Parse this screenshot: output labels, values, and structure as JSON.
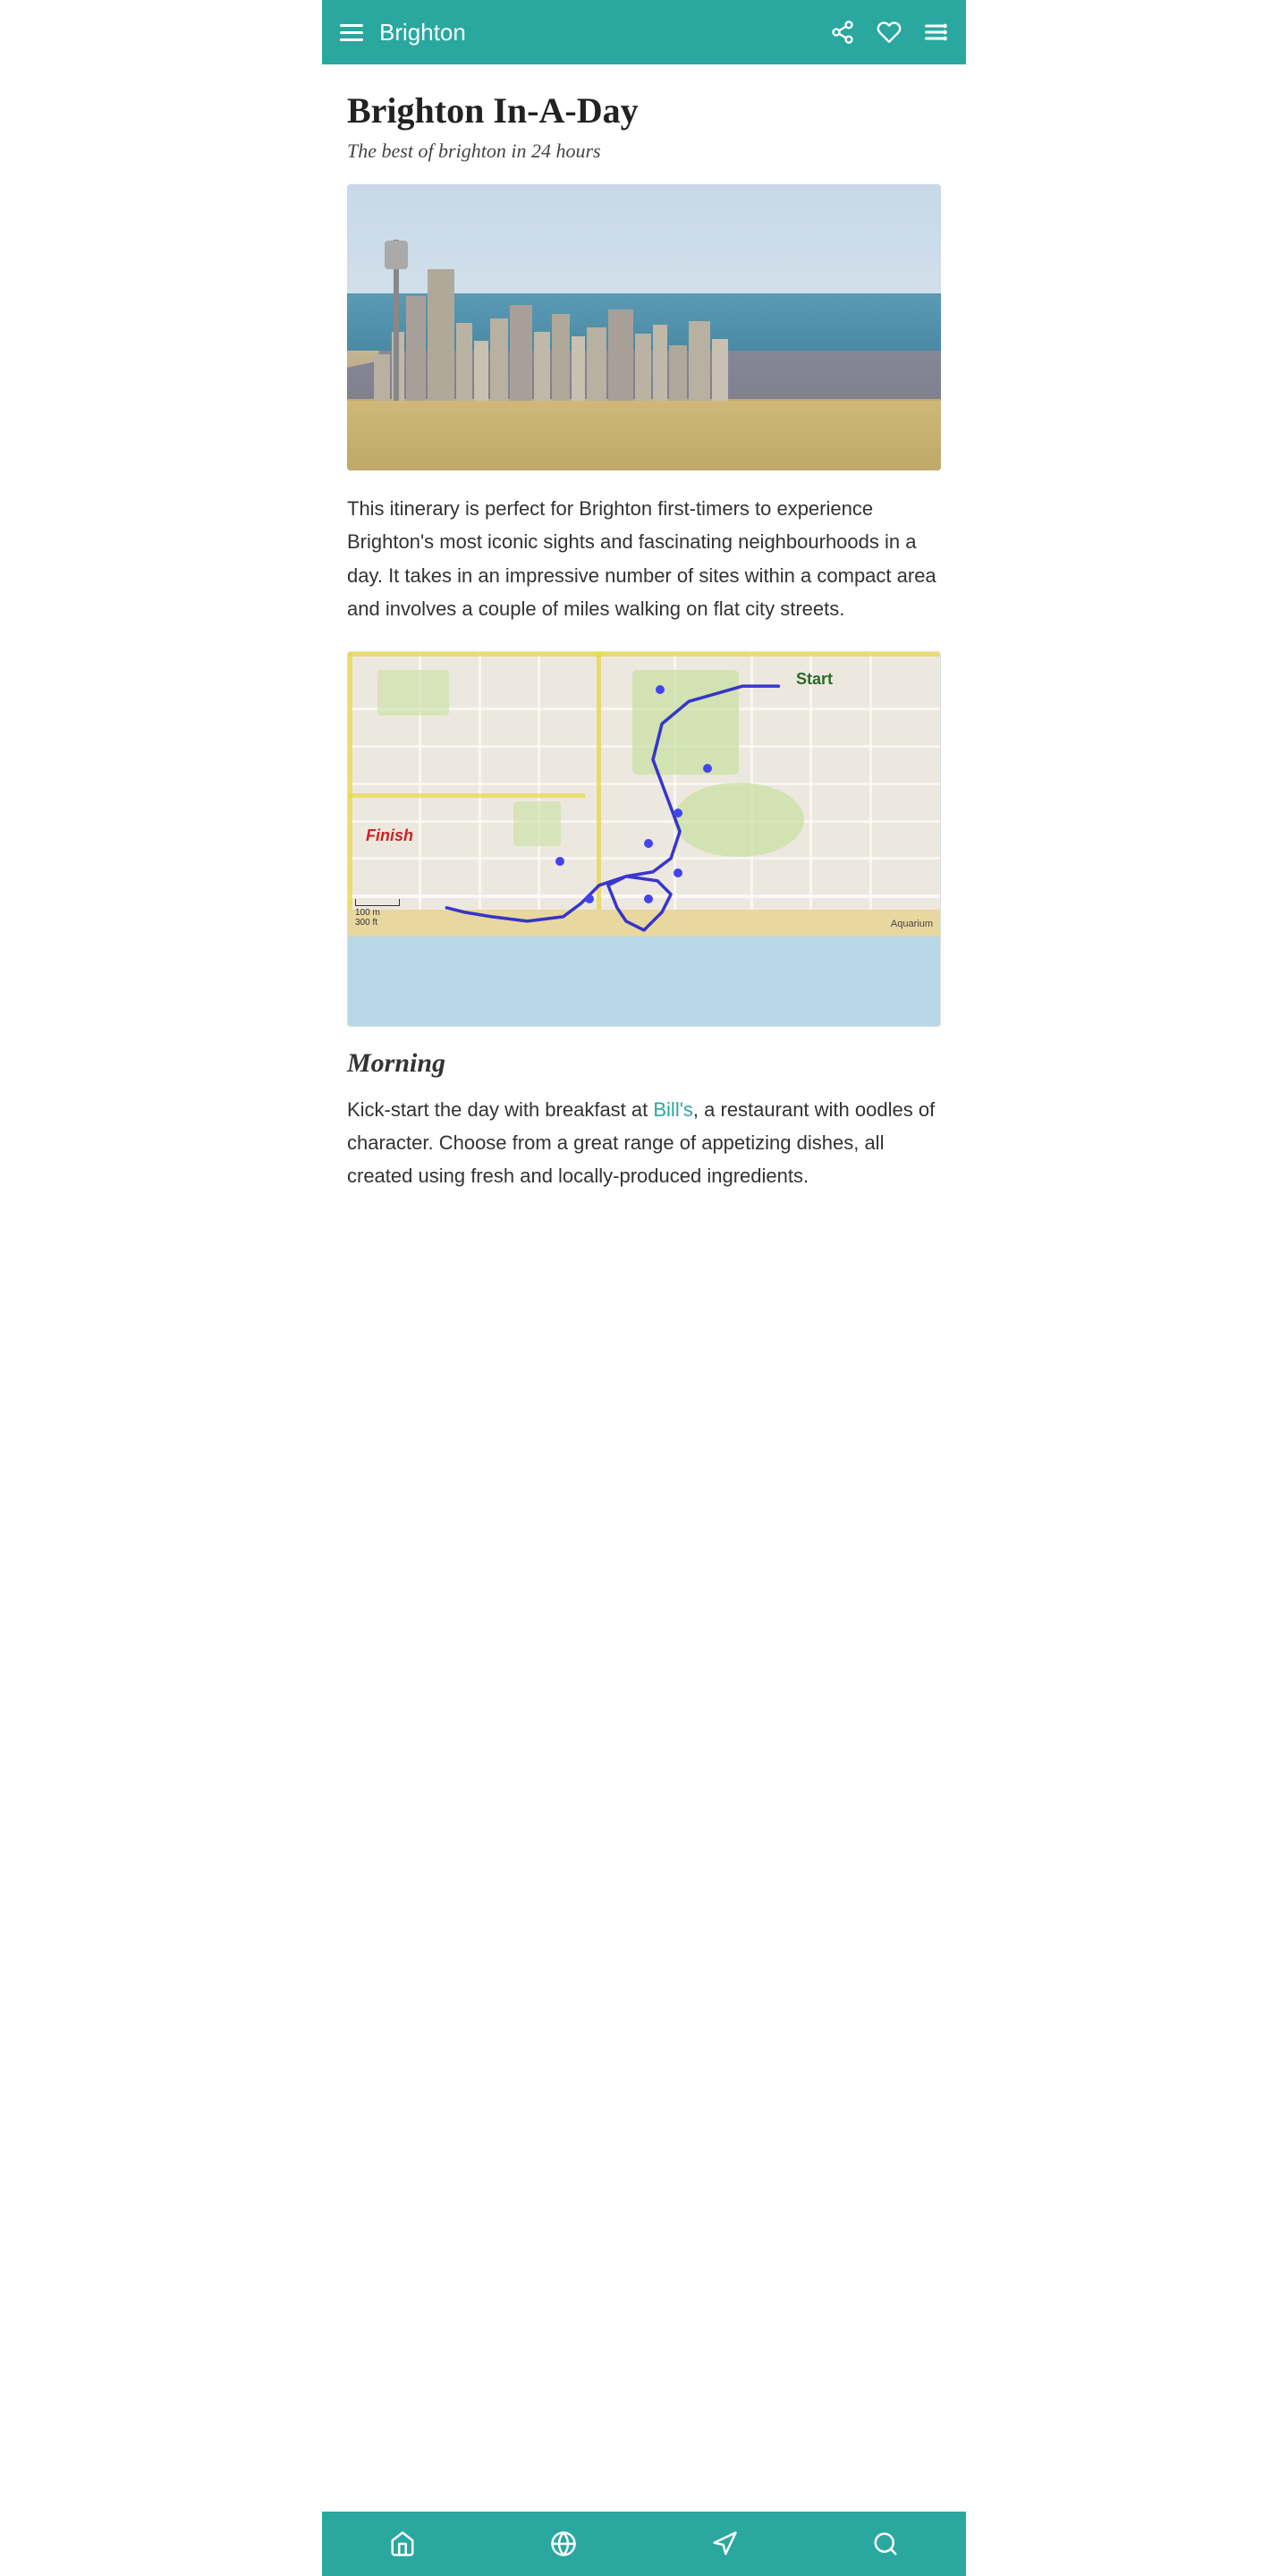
{
  "header": {
    "title": "Brighton",
    "share_label": "share",
    "heart_label": "favorite",
    "menu_label": "menu"
  },
  "article": {
    "title": "Brighton In-A-Day",
    "subtitle": "The best of brighton in 24 hours",
    "body": "This itinerary is perfect for Brighton first-timers to experience Brighton's most iconic sights and fascinating neighbourhoods in a day. It takes in an impressive number of sites within a compact area and involves a couple of miles walking on flat city streets.",
    "morning_heading": "Morning",
    "morning_body_before_link": "Kick-start the day with breakfast at ",
    "morning_link_text": "Bill's",
    "morning_body_after_link": ", a restaurant with oodles of character. Choose from a great range of appetizing dishes, all created using fresh and locally-produced ingredients.",
    "map_start_label": "Start",
    "map_finish_label": "Finish",
    "map_aquarium_label": "Aquarium",
    "map_scale_m": "100 m",
    "map_scale_ft": "300 ft"
  },
  "bottom_nav": {
    "home_label": "home",
    "explore_label": "explore",
    "directions_label": "directions",
    "search_label": "search"
  },
  "colors": {
    "teal": "#2aa8a0",
    "link": "#2a7ab8"
  }
}
